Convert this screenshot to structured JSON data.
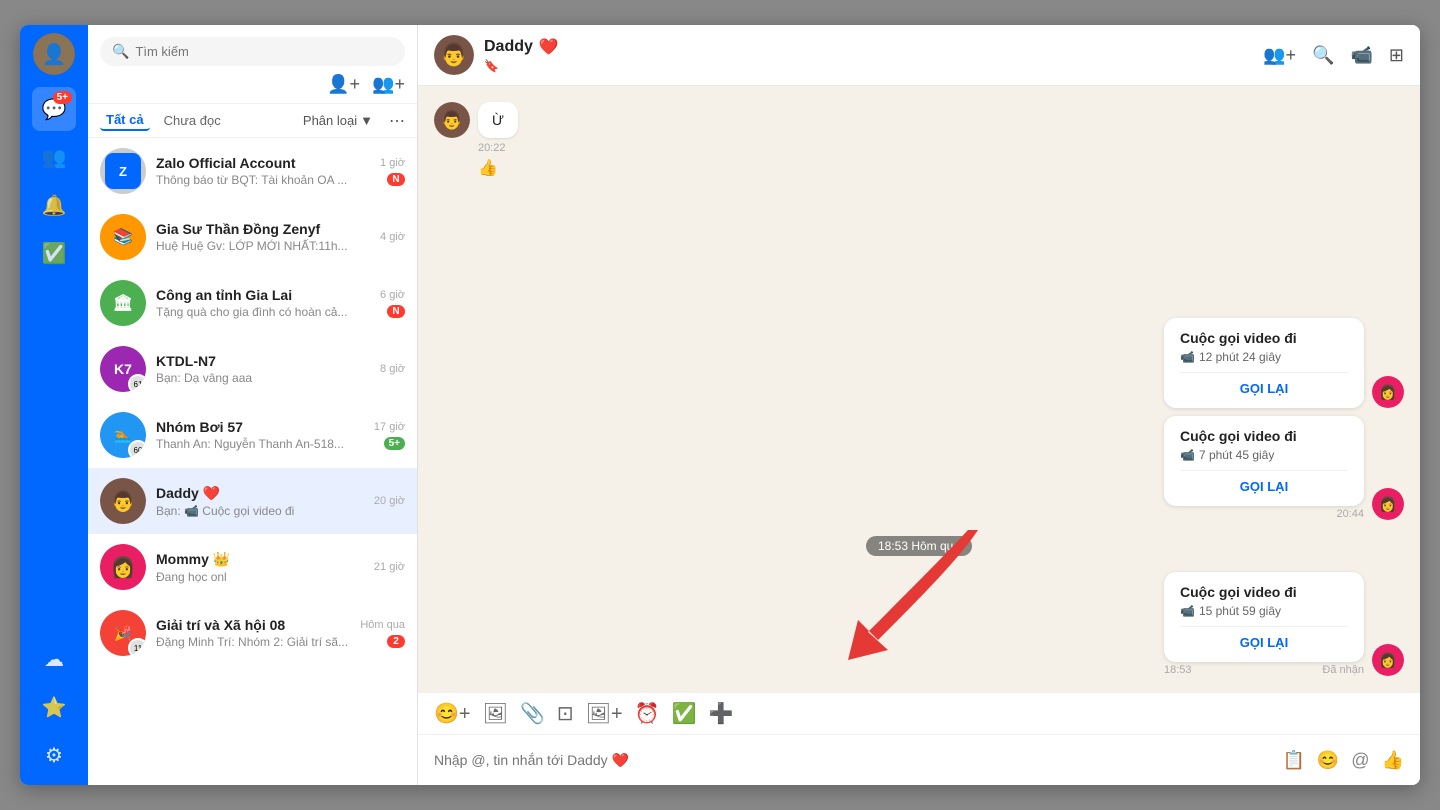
{
  "app": {
    "title": "Zalo"
  },
  "sidebar": {
    "avatar_bg": "#8b7355",
    "badge": "5+",
    "icons": [
      {
        "name": "chat-icon",
        "symbol": "💬",
        "active": true,
        "badge": "5+"
      },
      {
        "name": "contacts-icon",
        "symbol": "👥",
        "active": false
      },
      {
        "name": "notification-icon",
        "symbol": "🔔",
        "active": false
      },
      {
        "name": "todo-icon",
        "symbol": "✅",
        "active": false
      },
      {
        "name": "cloud-icon",
        "symbol": "☁",
        "active": false
      },
      {
        "name": "star-icon",
        "symbol": "⭐",
        "active": false
      },
      {
        "name": "settings-icon",
        "symbol": "⚙",
        "active": false
      }
    ]
  },
  "chat_list": {
    "search_placeholder": "Tìm kiếm",
    "filter_all": "Tất cả",
    "filter_unread": "Chưa đọc",
    "filter_classify": "Phân loại",
    "items": [
      {
        "id": 1,
        "name": "Zalo Official Account",
        "avatar_type": "zalo",
        "preview": "Thông báo từ BQT: Tài khoản OA ...",
        "time": "1 giờ",
        "badge": "N",
        "badge_color": "red"
      },
      {
        "id": 2,
        "name": "Gia Sư Thần Đồng Zenyf",
        "avatar_type": "group",
        "preview": "Huệ Huệ Gv: LỚP MỚI NHẤT:11h...",
        "time": "4 giờ",
        "badge": "",
        "badge_color": ""
      },
      {
        "id": 3,
        "name": "Công an tỉnh Gia Lai",
        "avatar_type": "group2",
        "preview": "Tặng quà cho gia đình có hoàn cả...",
        "time": "6 giờ",
        "badge": "N",
        "badge_color": "red"
      },
      {
        "id": 4,
        "name": "KTDL-N7",
        "avatar_type": "group3",
        "preview": "Bạn: Dạ vâng aaa",
        "time": "8 giờ",
        "badge": "",
        "badge_color": "",
        "member_count": "61"
      },
      {
        "id": 5,
        "name": "Nhóm Bơi 57",
        "avatar_type": "group4",
        "preview": "Thanh An: Nguyễn Thanh An-518...",
        "time": "17 giờ",
        "badge": "5+",
        "badge_color": "green",
        "member_count": "60"
      },
      {
        "id": 6,
        "name": "Daddy ❤️",
        "avatar_type": "daddy",
        "preview": "Bạn: 📹 Cuộc gọi video đi",
        "time": "20 giờ",
        "badge": "",
        "active": true
      },
      {
        "id": 7,
        "name": "Mommy 👑",
        "avatar_type": "mommy",
        "preview": "Đang học onl",
        "time": "21 giờ",
        "badge": ""
      },
      {
        "id": 8,
        "name": "Giải trí và Xã hội 08",
        "avatar_type": "group5",
        "preview": "Đặng Minh Trí: Nhóm 2: Giải trí sã...",
        "time": "Hôm qua",
        "badge": "2",
        "badge_color": "red",
        "member_count": "11"
      }
    ]
  },
  "chat_header": {
    "name": "Daddy",
    "heart": "❤️",
    "sub_icon": "🔖",
    "icons": [
      "👥+",
      "🔍",
      "📹",
      "⊞"
    ]
  },
  "messages": [
    {
      "id": 1,
      "type": "incoming",
      "text": "Ừ",
      "time": "20:22",
      "reaction": "👍"
    },
    {
      "id": 2,
      "type": "divider",
      "label": "18:53 Hôm qua"
    },
    {
      "id": 3,
      "type": "outgoing_call",
      "title": "Cuộc gọi video đi",
      "duration": "12 phút 24 giây",
      "time": "",
      "call_back": "GỌI LẠI"
    },
    {
      "id": 4,
      "type": "outgoing_call",
      "title": "Cuộc gọi video đi",
      "duration": "7 phút 45 giây",
      "time": "20:44",
      "call_back": "GỌI LẠI"
    },
    {
      "id": 5,
      "type": "outgoing_call",
      "title": "Cuộc gọi video đi",
      "duration": "15 phút 59 giây",
      "time": "18:53",
      "call_back": "GỌI LẠI",
      "status": "Đã nhận"
    }
  ],
  "toolbar": {
    "buttons": [
      "😊+",
      "🖼",
      "📎",
      "⊡",
      "🖼+",
      "⏰",
      "✅",
      "➕"
    ]
  },
  "input": {
    "placeholder": "Nhập @, tin nhắn tới Daddy ❤️",
    "right_buttons": [
      "📋",
      "😊",
      "@",
      "👍"
    ]
  },
  "red_arrow": {
    "visible": true
  }
}
